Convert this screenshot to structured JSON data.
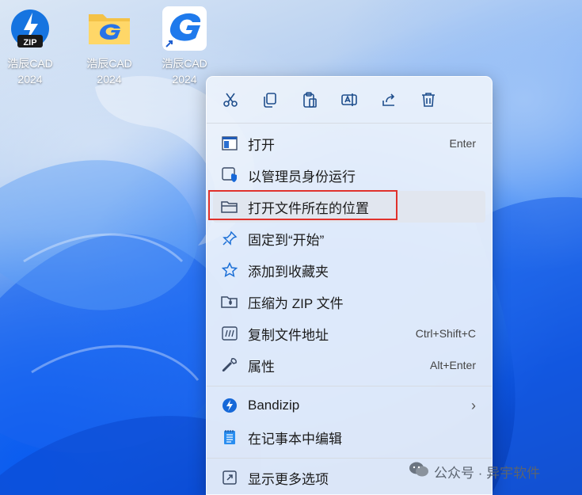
{
  "desktop": {
    "icons": [
      {
        "name": "浩辰CAD",
        "year": "2024",
        "badge": "ZIP"
      },
      {
        "name": "浩辰CAD",
        "year": "2024"
      },
      {
        "name": "浩辰CAD",
        "year": "2024"
      }
    ]
  },
  "context_menu": {
    "toolbar": [
      "cut-icon",
      "copy-icon",
      "paste-icon",
      "rename-icon",
      "share-icon",
      "delete-icon"
    ],
    "items": [
      {
        "label": "打开",
        "shortcut": "Enter",
        "icon": "app-window-icon"
      },
      {
        "label": "以管理员身份运行",
        "shortcut": "",
        "icon": "shield-icon"
      },
      {
        "label": "打开文件所在的位置",
        "shortcut": "",
        "icon": "folder-icon",
        "highlighted": true
      },
      {
        "label": "固定到“开始”",
        "shortcut": "",
        "icon": "pin-icon"
      },
      {
        "label": "添加到收藏夹",
        "shortcut": "",
        "icon": "star-icon"
      },
      {
        "label": "压缩为 ZIP 文件",
        "shortcut": "",
        "icon": "zip-folder-icon"
      },
      {
        "label": "复制文件地址",
        "shortcut": "Ctrl+Shift+C",
        "icon": "copy-path-icon"
      },
      {
        "label": "属性",
        "shortcut": "Alt+Enter",
        "icon": "wrench-icon"
      },
      {
        "label": "Bandizip",
        "shortcut": "",
        "icon": "bandizip-icon",
        "submenu": true
      },
      {
        "label": "在记事本中编辑",
        "shortcut": "",
        "icon": "notepad-icon"
      },
      {
        "label": "显示更多选项",
        "shortcut": "",
        "icon": "more-options-icon"
      }
    ]
  },
  "watermark": {
    "text": "公众号 · 异宇软件"
  },
  "colors": {
    "accent": "#0067c0",
    "highlight_border": "#e0312b"
  }
}
